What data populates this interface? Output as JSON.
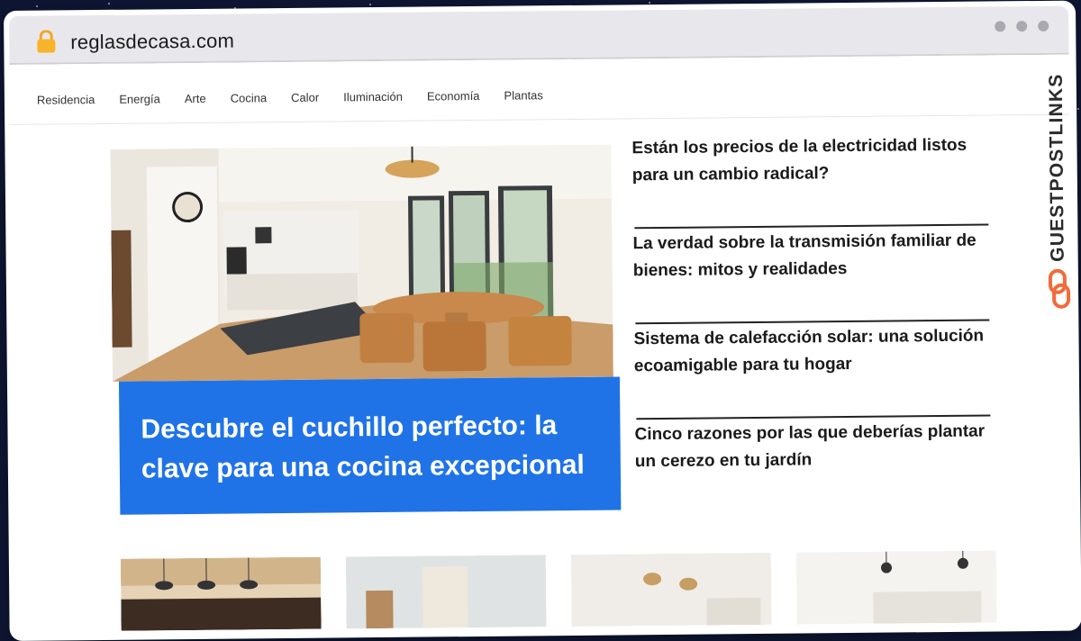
{
  "browser": {
    "url": "reglasdecasa.com",
    "lock_icon": "lock-icon"
  },
  "nav": {
    "items": [
      {
        "label": "Residencia"
      },
      {
        "label": "Energía"
      },
      {
        "label": "Arte"
      },
      {
        "label": "Cocina"
      },
      {
        "label": "Calor"
      },
      {
        "label": "Iluminación"
      },
      {
        "label": "Economía"
      },
      {
        "label": "Plantas"
      }
    ]
  },
  "side_brand": {
    "text": "GUESTPOSTLINKS",
    "icon": "link-logo-icon",
    "color": "#f26b3a"
  },
  "hero": {
    "image": "kitchen-dining-room-photo",
    "title": "Descubre el cuchillo perfecto: la clave para una cocina excepcional",
    "accent": "#1f73e6"
  },
  "articles": [
    {
      "title": "Están los precios de la electricidad listos para un cambio radical?"
    },
    {
      "title": "La verdad sobre la transmisión familiar de bienes: mitos y realidades"
    },
    {
      "title": "Sistema de calefacción solar: una solución ecoamigable para tu hogar"
    },
    {
      "title": "Cinco razones por las que deberías plantar un cerezo en tu jardín"
    }
  ],
  "thumbnails": [
    {
      "image": "wooden-ceiling-pendant-lamps-photo"
    },
    {
      "image": "macrame-wall-hanging-room-photo"
    },
    {
      "image": "white-kitchen-wicker-lamps-photo"
    },
    {
      "image": "white-kitchen-pendant-lights-photo"
    }
  ]
}
